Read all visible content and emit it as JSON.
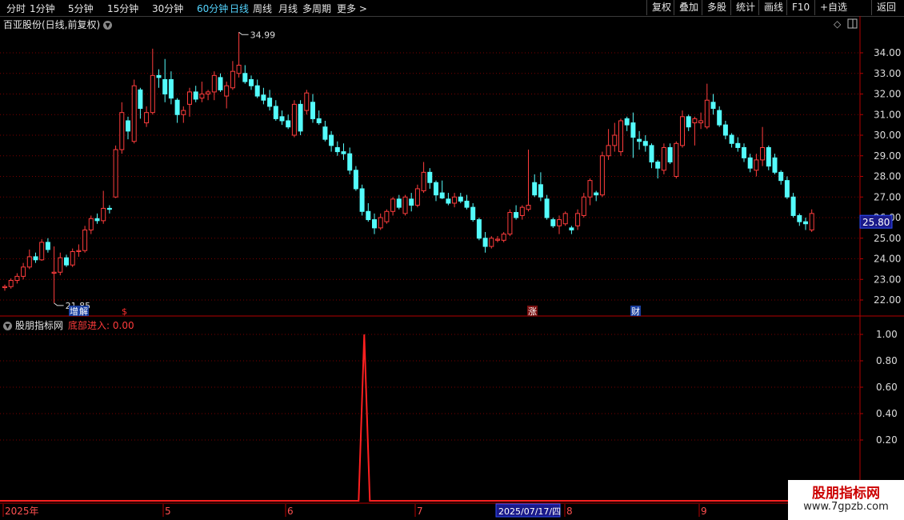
{
  "toolbar": {
    "left": [
      "分时",
      "1分钟",
      "5分钟",
      "15分钟",
      "30分钟",
      "60分钟",
      "日线",
      "周线",
      "月线",
      "多周期",
      "更多 >"
    ],
    "active": "日线",
    "right": [
      "复权",
      "叠加",
      "多股",
      "统计",
      "画线",
      "F10",
      "+自选",
      "返回"
    ]
  },
  "main_panel": {
    "title": "百亚股份(日线,前复权)",
    "y_ticks": [
      "34.00",
      "33.00",
      "32.00",
      "31.00",
      "30.00",
      "29.00",
      "28.00",
      "27.00",
      "26.00",
      "25.00",
      "24.00",
      "23.00",
      "22.00"
    ],
    "current_price": "25.80",
    "high_label": "34.99",
    "low_label": "21.85",
    "event_markers": [
      {
        "text": "增",
        "color": "#ffffff",
        "bg": "#1a3fa0"
      },
      {
        "text": "解",
        "color": "#ffffff",
        "bg": "#1a3fa0"
      },
      {
        "text": "$",
        "color": "#ff3030",
        "bg": ""
      },
      {
        "text": "涨",
        "color": "#ffffff",
        "bg": "#7a1010"
      },
      {
        "text": "财",
        "color": "#ffffff",
        "bg": "#1a3fa0"
      }
    ]
  },
  "indicator_panel": {
    "title": "股朋指标网",
    "indicator_label": "底部进入: 0.00",
    "y_ticks": [
      "1.00",
      "0.80",
      "0.60",
      "0.40",
      "0.20"
    ]
  },
  "date_axis": {
    "labels": [
      "2025年",
      "5",
      "6",
      "7",
      "8",
      "9"
    ],
    "cursor_label": "2025/07/17/四"
  },
  "watermark": {
    "line1": "股朋指标网",
    "line2": "www.7gpzb.com"
  },
  "colors": {
    "up": "#ff3c3c",
    "down": "#54fcfc",
    "grid": "#7a0000",
    "axis": "#b40000",
    "indicator": "#ff2020"
  },
  "chart_data": [
    {
      "type": "candlestick",
      "title": "百亚股份(日线,前复权)",
      "y_range": [
        21.5,
        35.2
      ],
      "candles": [
        [
          22.6,
          22.75,
          22.45,
          22.65
        ],
        [
          22.65,
          23.05,
          22.55,
          22.95
        ],
        [
          22.95,
          23.3,
          22.8,
          23.15
        ],
        [
          23.15,
          23.8,
          23.0,
          23.6
        ],
        [
          23.6,
          24.45,
          23.5,
          24.1
        ],
        [
          24.1,
          24.3,
          23.8,
          23.95
        ],
        [
          23.95,
          24.95,
          23.9,
          24.8
        ],
        [
          24.8,
          25.0,
          24.3,
          24.45
        ],
        [
          23.3,
          24.6,
          21.85,
          23.35
        ],
        [
          23.35,
          24.3,
          23.2,
          24.05
        ],
        [
          24.05,
          24.2,
          23.6,
          23.7
        ],
        [
          23.7,
          24.5,
          23.6,
          24.35
        ],
        [
          24.35,
          24.7,
          24.1,
          24.4
        ],
        [
          24.4,
          25.6,
          24.3,
          25.4
        ],
        [
          25.4,
          26.1,
          25.2,
          25.95
        ],
        [
          25.95,
          26.2,
          25.7,
          25.85
        ],
        [
          25.85,
          27.3,
          25.7,
          26.45
        ],
        [
          26.45,
          26.6,
          26.2,
          26.4
        ],
        [
          27.0,
          29.5,
          26.95,
          29.3
        ],
        [
          29.3,
          31.6,
          29.1,
          31.1
        ],
        [
          30.7,
          30.9,
          29.8,
          30.2
        ],
        [
          29.7,
          32.7,
          29.6,
          32.4
        ],
        [
          32.2,
          32.3,
          30.8,
          31.3
        ],
        [
          30.6,
          31.4,
          30.4,
          31.1
        ],
        [
          31.1,
          34.2,
          31.0,
          32.9
        ],
        [
          32.9,
          33.2,
          32.3,
          32.8
        ],
        [
          32.7,
          33.7,
          31.6,
          32.0
        ],
        [
          32.7,
          33.1,
          31.5,
          31.8
        ],
        [
          31.7,
          31.8,
          30.6,
          31.0
        ],
        [
          31.0,
          31.4,
          30.6,
          31.2
        ],
        [
          31.5,
          32.3,
          30.9,
          32.1
        ],
        [
          32.1,
          32.4,
          31.6,
          31.75
        ],
        [
          31.8,
          32.6,
          31.6,
          32.0
        ],
        [
          32.0,
          32.2,
          31.7,
          32.1
        ],
        [
          32.1,
          33.1,
          31.7,
          32.9
        ],
        [
          32.8,
          33.0,
          32.1,
          32.2
        ],
        [
          31.9,
          32.6,
          31.3,
          32.4
        ],
        [
          32.3,
          33.6,
          32.2,
          33.1
        ],
        [
          33.0,
          35.0,
          32.8,
          33.4
        ],
        [
          33.0,
          33.4,
          32.5,
          32.6
        ],
        [
          32.7,
          32.9,
          32.2,
          32.4
        ],
        [
          32.4,
          32.7,
          31.8,
          31.9
        ],
        [
          31.95,
          32.3,
          31.5,
          31.7
        ],
        [
          31.8,
          32.2,
          31.2,
          31.4
        ],
        [
          31.4,
          31.7,
          30.7,
          30.8
        ],
        [
          30.9,
          31.2,
          30.5,
          30.7
        ],
        [
          30.7,
          31.0,
          30.3,
          30.4
        ],
        [
          30.0,
          31.7,
          29.9,
          31.5
        ],
        [
          31.5,
          31.7,
          30.0,
          30.2
        ],
        [
          31.2,
          32.2,
          31.0,
          32.05
        ],
        [
          31.6,
          32.0,
          30.6,
          30.8
        ],
        [
          30.8,
          31.2,
          30.5,
          30.6
        ],
        [
          30.4,
          30.7,
          29.7,
          29.8
        ],
        [
          30.0,
          30.2,
          29.2,
          29.5
        ],
        [
          29.4,
          29.7,
          29.0,
          29.2
        ],
        [
          29.2,
          29.6,
          28.8,
          29.1
        ],
        [
          29.1,
          29.4,
          28.1,
          28.3
        ],
        [
          28.3,
          28.5,
          27.3,
          27.4
        ],
        [
          27.4,
          27.6,
          26.1,
          26.3
        ],
        [
          26.3,
          26.7,
          25.8,
          25.9
        ],
        [
          25.9,
          26.2,
          25.2,
          25.5
        ],
        [
          25.5,
          26.2,
          25.4,
          26.0
        ],
        [
          25.8,
          26.4,
          25.7,
          26.3
        ],
        [
          26.3,
          27.0,
          26.1,
          26.9
        ],
        [
          26.9,
          27.1,
          26.4,
          26.5
        ],
        [
          26.2,
          27.1,
          26.1,
          27.0
        ],
        [
          26.9,
          27.2,
          26.3,
          26.6
        ],
        [
          26.6,
          27.6,
          26.5,
          27.4
        ],
        [
          27.3,
          28.7,
          27.2,
          28.2
        ],
        [
          28.2,
          28.4,
          27.4,
          27.7
        ],
        [
          27.7,
          27.8,
          26.8,
          27.1
        ],
        [
          27.2,
          27.8,
          26.9,
          26.95
        ],
        [
          26.9,
          27.2,
          26.6,
          26.7
        ],
        [
          26.7,
          27.2,
          26.5,
          27.0
        ],
        [
          27.0,
          27.2,
          26.7,
          26.8
        ],
        [
          26.8,
          27.1,
          26.4,
          26.5
        ],
        [
          26.5,
          26.7,
          25.8,
          25.9
        ],
        [
          25.9,
          26.0,
          24.9,
          25.0
        ],
        [
          25.0,
          25.3,
          24.3,
          24.6
        ],
        [
          24.6,
          25.1,
          24.5,
          25.0
        ],
        [
          24.9,
          25.1,
          24.8,
          24.95
        ],
        [
          24.9,
          25.3,
          24.8,
          25.2
        ],
        [
          25.2,
          26.4,
          25.1,
          26.25
        ],
        [
          26.25,
          26.6,
          25.9,
          26.0
        ],
        [
          26.1,
          26.6,
          25.9,
          26.5
        ],
        [
          26.4,
          29.3,
          26.3,
          26.6
        ],
        [
          27.7,
          28.1,
          27.0,
          27.1
        ],
        [
          27.6,
          28.2,
          26.8,
          27.0
        ],
        [
          26.9,
          27.1,
          25.9,
          26.0
        ],
        [
          25.9,
          26.0,
          25.5,
          25.6
        ],
        [
          25.6,
          26.1,
          25.2,
          25.9
        ],
        [
          25.7,
          26.3,
          25.6,
          26.2
        ],
        [
          25.5,
          25.6,
          25.2,
          25.4
        ],
        [
          25.6,
          26.4,
          25.4,
          26.2
        ],
        [
          26.1,
          27.2,
          26.0,
          27.0
        ],
        [
          27.0,
          27.9,
          26.6,
          27.8
        ],
        [
          27.2,
          27.3,
          26.8,
          27.1
        ],
        [
          27.1,
          29.2,
          27.0,
          29.0
        ],
        [
          29.0,
          30.3,
          28.8,
          29.5
        ],
        [
          29.5,
          30.6,
          29.2,
          30.0
        ],
        [
          29.2,
          30.8,
          29.0,
          30.7
        ],
        [
          30.8,
          30.9,
          30.2,
          30.5
        ],
        [
          30.6,
          31.1,
          28.9,
          29.9
        ],
        [
          29.8,
          30.2,
          29.3,
          29.7
        ],
        [
          29.7,
          30.0,
          29.2,
          29.5
        ],
        [
          29.5,
          29.6,
          28.4,
          28.7
        ],
        [
          28.7,
          28.8,
          27.9,
          28.4
        ],
        [
          28.3,
          29.6,
          28.1,
          29.4
        ],
        [
          29.4,
          29.6,
          28.6,
          28.7
        ],
        [
          28.0,
          29.7,
          27.9,
          29.6
        ],
        [
          29.5,
          31.2,
          29.4,
          30.9
        ],
        [
          30.9,
          31.0,
          30.2,
          30.4
        ],
        [
          30.6,
          30.9,
          29.5,
          30.8
        ],
        [
          30.6,
          31.1,
          30.3,
          30.7
        ],
        [
          30.4,
          32.5,
          30.3,
          31.7
        ],
        [
          31.6,
          32.0,
          31.0,
          31.3
        ],
        [
          31.2,
          31.4,
          30.4,
          30.5
        ],
        [
          30.5,
          30.7,
          29.8,
          30.0
        ],
        [
          30.0,
          30.1,
          29.4,
          29.6
        ],
        [
          29.6,
          29.9,
          29.2,
          29.4
        ],
        [
          29.4,
          29.6,
          28.7,
          28.9
        ],
        [
          28.9,
          29.1,
          28.2,
          28.4
        ],
        [
          28.3,
          29.1,
          28.0,
          28.8
        ],
        [
          28.8,
          30.4,
          28.5,
          29.4
        ],
        [
          29.4,
          29.5,
          28.3,
          28.5
        ],
        [
          28.9,
          29.1,
          28.1,
          28.2
        ],
        [
          28.2,
          28.3,
          27.6,
          27.8
        ],
        [
          27.8,
          28.0,
          26.9,
          27.0
        ],
        [
          27.0,
          27.2,
          26.0,
          26.1
        ],
        [
          26.1,
          26.2,
          25.6,
          25.8
        ],
        [
          25.8,
          26.0,
          25.4,
          25.7
        ],
        [
          25.4,
          26.4,
          25.3,
          26.2
        ]
      ]
    },
    {
      "type": "line",
      "title": "股朋指标网",
      "series": [
        {
          "name": "底部进入",
          "spikes": [
            {
              "index": 59,
              "value": 1.0
            }
          ],
          "baseline": 0.0
        }
      ],
      "ylim": [
        0,
        1.05
      ]
    }
  ]
}
